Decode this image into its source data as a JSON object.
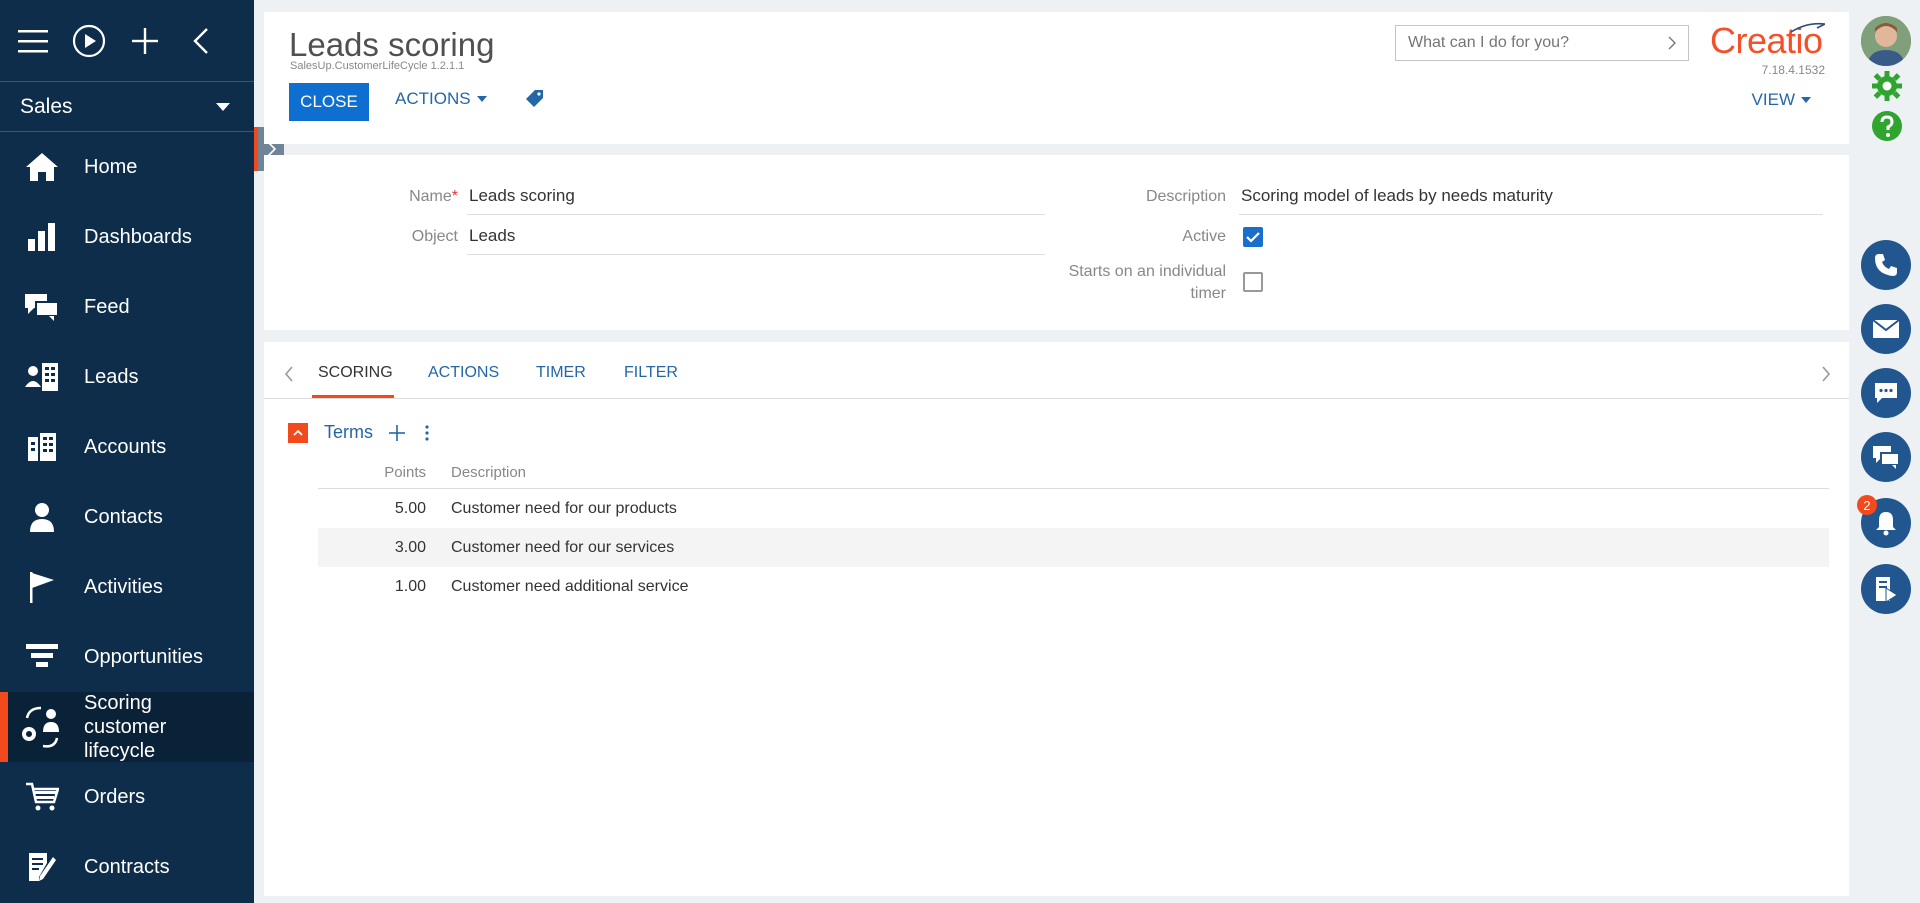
{
  "sidebar": {
    "workplace": "Sales",
    "items": [
      {
        "label": "Home"
      },
      {
        "label": "Dashboards"
      },
      {
        "label": "Feed"
      },
      {
        "label": "Leads"
      },
      {
        "label": "Accounts"
      },
      {
        "label": "Contacts"
      },
      {
        "label": "Activities"
      },
      {
        "label": "Opportunities"
      },
      {
        "label": "Scoring customer lifecycle"
      },
      {
        "label": "Orders"
      },
      {
        "label": "Contracts"
      }
    ]
  },
  "header": {
    "title": "Leads scoring",
    "subtitle": "SalesUp.CustomerLifeCycle 1.2.1.1",
    "close_label": "CLOSE",
    "actions_label": "ACTIONS",
    "view_label": "VIEW",
    "search_placeholder": "What can I do for you?",
    "logo": "Creatio",
    "version": "7.18.4.1532"
  },
  "form": {
    "name_label": "Name",
    "name_value": "Leads scoring",
    "object_label": "Object",
    "object_value": "Leads",
    "description_label": "Description",
    "description_value": "Scoring model of leads by needs maturity",
    "active_label": "Active",
    "active_checked": true,
    "timer_label": "Starts on an individual timer",
    "timer_checked": false
  },
  "tabs": [
    {
      "label": "SCORING"
    },
    {
      "label": "ACTIONS"
    },
    {
      "label": "TIMER"
    },
    {
      "label": "FILTER"
    }
  ],
  "terms": {
    "title": "Terms",
    "columns": {
      "points": "Points",
      "description": "Description"
    },
    "rows": [
      {
        "points": "5.00",
        "description": "Customer need for our products"
      },
      {
        "points": "3.00",
        "description": "Customer need for our services"
      },
      {
        "points": "1.00",
        "description": "Customer need additional service"
      }
    ]
  },
  "notifications": {
    "count": "2"
  },
  "colors": {
    "accent": "#f24a1d",
    "primary": "#0e6fd1",
    "sidebar": "#0e2d4a",
    "link": "#2467a8"
  }
}
